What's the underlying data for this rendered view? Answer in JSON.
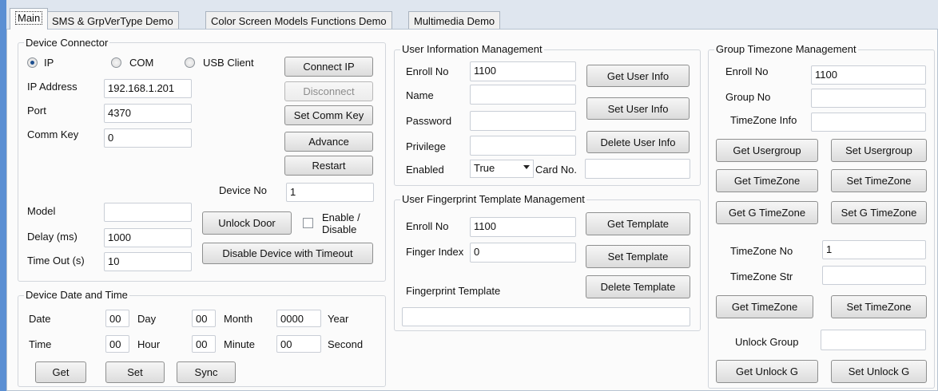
{
  "tabs": [
    "Main",
    "SMS & GrpVerType Demo",
    "Color Screen Models Functions Demo",
    "Multimedia Demo"
  ],
  "device_connector": {
    "title": "Device Connector",
    "radios": [
      "IP",
      "COM",
      "USB Client"
    ],
    "selected": "IP",
    "labels": {
      "ip": "IP Address",
      "port": "Port",
      "commkey": "Comm Key",
      "device_no": "Device No",
      "model": "Model",
      "delay": "Delay (ms)",
      "timeout": "Time Out (s)"
    },
    "values": {
      "ip": "192.168.1.201",
      "port": "4370",
      "commkey": "0",
      "device_no": "1",
      "model": "",
      "delay": "1000",
      "timeout": "10"
    },
    "buttons": {
      "connect": "Connect IP",
      "disconnect": "Disconnect",
      "set_comm_key": "Set Comm Key",
      "advance": "Advance",
      "restart": "Restart",
      "unlock_door": "Unlock Door",
      "disable_timeout": "Disable Device with Timeout"
    },
    "enable_label_1": "Enable /",
    "enable_label_2": "Disable"
  },
  "date_time": {
    "title": "Device Date and Time",
    "date_label": "Date",
    "time_label": "Time",
    "day_val": "00",
    "day_label": "Day",
    "month_val": "00",
    "month_label": "Month",
    "year_val": "0000",
    "year_label": "Year",
    "hour_val": "00",
    "hour_label": "Hour",
    "minute_val": "00",
    "minute_label": "Minute",
    "second_val": "00",
    "second_label": "Second",
    "buttons": {
      "get": "Get",
      "set": "Set",
      "sync": "Sync"
    }
  },
  "user_info": {
    "title": "User Information Management",
    "labels": {
      "enroll": "Enroll No",
      "name": "Name",
      "password": "Password",
      "privilege": "Privilege",
      "enabled": "Enabled",
      "card": "Card No."
    },
    "values": {
      "enroll": "1100",
      "name": "",
      "password": "",
      "privilege": "",
      "enabled": "True",
      "card": ""
    },
    "buttons": {
      "get": "Get User Info",
      "set": "Set User Info",
      "delete": "Delete User Info"
    }
  },
  "fingerprint": {
    "title": "User Fingerprint Template Management",
    "labels": {
      "enroll": "Enroll No",
      "finger_index": "Finger Index",
      "template": "Fingerprint Template"
    },
    "values": {
      "enroll": "1100",
      "finger_index": "0",
      "template": ""
    },
    "buttons": {
      "get": "Get Template",
      "set": "Set Template",
      "delete": "Delete Template"
    }
  },
  "group_tz": {
    "title": "Group Timezone Management",
    "labels": {
      "enroll": "Enroll No",
      "group_no": "Group No",
      "tz_info": "TimeZone Info",
      "tz_no": "TimeZone No",
      "tz_str": "TimeZone Str",
      "unlock_group": "Unlock Group"
    },
    "values": {
      "enroll": "1100",
      "group_no": "",
      "tz_info": "",
      "tz_no": "1",
      "tz_str": "",
      "unlock_group": ""
    },
    "buttons": {
      "get_usergroup": "Get Usergroup",
      "set_usergroup": "Set Usergroup",
      "get_timezone": "Get TimeZone",
      "set_timezone": "Set TimeZone",
      "get_g_timezone": "Get G TimeZone",
      "set_g_timezone": "Set G TimeZone",
      "get_timezone2": "Get TimeZone",
      "set_timezone2": "Set TimeZone",
      "get_unlock_g": "Get Unlock G",
      "set_unlock_g": "Set Unlock G"
    }
  }
}
